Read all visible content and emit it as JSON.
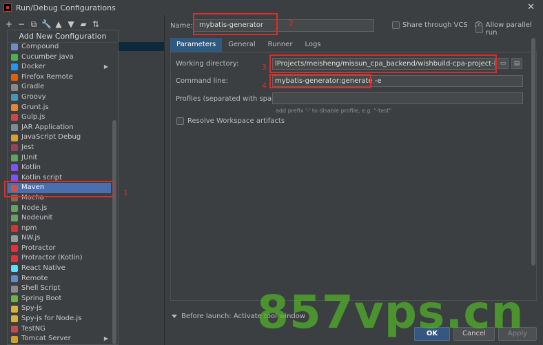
{
  "window": {
    "title": "Run/Debug Configurations"
  },
  "dropdown": {
    "header": "Add New Configuration",
    "items": [
      {
        "label": "Compound",
        "icon": "compound-icon",
        "color": "#6a8fc8"
      },
      {
        "label": "Cucumber java",
        "icon": "cucumber-icon",
        "color": "#4caf50"
      },
      {
        "label": "Docker",
        "icon": "docker-icon",
        "color": "#2496ed",
        "submenu": true
      },
      {
        "label": "Firefox Remote",
        "icon": "firefox-icon",
        "color": "#e66000"
      },
      {
        "label": "Gradle",
        "icon": "gradle-icon",
        "color": "#888888"
      },
      {
        "label": "Groovy",
        "icon": "groovy-icon",
        "color": "#4298b8"
      },
      {
        "label": "Grunt.js",
        "icon": "grunt-icon",
        "color": "#e48632"
      },
      {
        "label": "Gulp.js",
        "icon": "gulp-icon",
        "color": "#cf4646"
      },
      {
        "label": "JAR Application",
        "icon": "jar-icon",
        "color": "#7c8b9a"
      },
      {
        "label": "JavaScript Debug",
        "icon": "javascript-debug-icon",
        "color": "#d9a02b"
      },
      {
        "label": "Jest",
        "icon": "jest-icon",
        "color": "#99425b"
      },
      {
        "label": "JUnit",
        "icon": "junit-icon",
        "color": "#5ea35e"
      },
      {
        "label": "Kotlin",
        "icon": "kotlin-icon",
        "color": "#7f52ff"
      },
      {
        "label": "Kotlin script",
        "icon": "kotlin-script-icon",
        "color": "#7f52ff"
      },
      {
        "label": "Maven",
        "icon": "maven-icon",
        "color": "#c75450",
        "selected": true
      },
      {
        "label": "Mocha",
        "icon": "mocha-icon",
        "color": "#8d6748"
      },
      {
        "label": "Node.js",
        "icon": "nodejs-icon",
        "color": "#68a063"
      },
      {
        "label": "Nodeunit",
        "icon": "nodeunit-icon",
        "color": "#68a063"
      },
      {
        "label": "npm",
        "icon": "npm-icon",
        "color": "#cb3837"
      },
      {
        "label": "NW.js",
        "icon": "nwjs-icon",
        "color": "#999999"
      },
      {
        "label": "Protractor",
        "icon": "protractor-icon",
        "color": "#e23237"
      },
      {
        "label": "Protractor (Kotlin)",
        "icon": "protractor-kotlin-icon",
        "color": "#e23237"
      },
      {
        "label": "React Native",
        "icon": "react-native-icon",
        "color": "#61dafb"
      },
      {
        "label": "Remote",
        "icon": "remote-icon",
        "color": "#5f8fc8"
      },
      {
        "label": "Shell Script",
        "icon": "shell-script-icon",
        "color": "#8a8a8a"
      },
      {
        "label": "Spring Boot",
        "icon": "spring-boot-icon",
        "color": "#6db33f"
      },
      {
        "label": "Spy-js",
        "icon": "spy-js-icon",
        "color": "#d7b33c"
      },
      {
        "label": "Spy-js for Node.js",
        "icon": "spy-js-node-icon",
        "color": "#d7b33c"
      },
      {
        "label": "TestNG",
        "icon": "testng-icon",
        "color": "#c24c4c"
      },
      {
        "label": "Tomcat Server",
        "icon": "tomcat-icon",
        "color": "#d1a023",
        "submenu": true
      }
    ]
  },
  "form": {
    "name_label": "Name:",
    "name_value": "mybatis-generator",
    "share_vcs_label": "Share through VCS",
    "allow_parallel_label": "Allow parallel run",
    "tabs": [
      "Parameters",
      "General",
      "Runner",
      "Logs"
    ],
    "active_tab": "Parameters",
    "working_directory_label": "Working directory:",
    "working_directory_value": "lProjects/meisheng/missun_cpa_backend/wishbuild-cpa-project-bootstrap",
    "command_line_label": "Command line:",
    "command_line_value": "mybatis-generator:generate -e",
    "profiles_label": "Profiles (separated with space):",
    "profiles_value": "",
    "profiles_hint": "add prefix '-' to disable profile, e.g. \"-test\"",
    "resolve_workspace_label": "Resolve Workspace artifacts",
    "before_launch_label": "Before launch: Activate tool window"
  },
  "buttons": {
    "ok": "OK",
    "cancel": "Cancel",
    "apply": "Apply"
  },
  "annotations": {
    "n1": "1",
    "n2": "2",
    "n3": "3",
    "n4": "4"
  },
  "watermark": "857vps.cn"
}
